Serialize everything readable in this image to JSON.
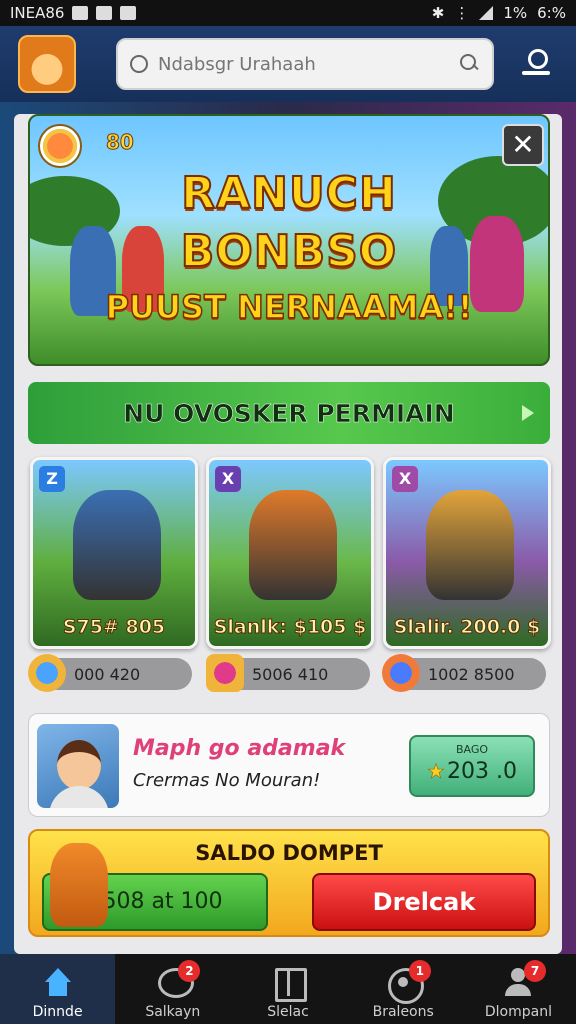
{
  "status_bar": {
    "left_text": "INEA86",
    "battery": "1%",
    "time": "6:%"
  },
  "header": {
    "search_placeholder": "Ndabsgr Urahaah"
  },
  "hero": {
    "score": "80",
    "title_line1": "RANUCH",
    "title_line2": "BONBSO",
    "subtitle": "PUUST NERNAAMA!!",
    "close_label": "✕"
  },
  "green_banner": {
    "label": "NU OVOSKER PERMIAIN"
  },
  "games": [
    {
      "tag": "Z",
      "tag_color": "#2a7de1",
      "price": "S75# 805",
      "stat": "000 420",
      "bg": "#5fae3e",
      "accent": "#3b6fb3"
    },
    {
      "tag": "X",
      "tag_color": "#6a3fb0",
      "price": "Slanlk: $105 $",
      "stat": "5006 410",
      "bg": "#6ab84a",
      "accent": "#e07a2a"
    },
    {
      "tag": "X",
      "tag_color": "#a04aa8",
      "price": "Slalir. 200.0 $",
      "stat": "1002 8500",
      "bg": "#8a5aa8",
      "accent": "#e3a43a"
    }
  ],
  "profile": {
    "name": "Maph go adamak",
    "subtitle": "Crermas No Mouran!",
    "reward_label": "BAGO",
    "reward_value": "203 .0"
  },
  "wallet": {
    "title": "SALDO DOMPET",
    "balance_label": "A508 at 100",
    "withdraw_label": "Drelcak"
  },
  "bottom_nav": [
    {
      "label": "Dinnde",
      "icon": "home-icon",
      "active": true,
      "badge": ""
    },
    {
      "label": "Salkayn",
      "icon": "chat-icon",
      "active": false,
      "badge": "2"
    },
    {
      "label": "Slelac",
      "icon": "book-icon",
      "active": false,
      "badge": ""
    },
    {
      "label": "Braleons",
      "icon": "shield-icon",
      "active": false,
      "badge": "1"
    },
    {
      "label": "Dlompanl",
      "icon": "person-icon",
      "active": false,
      "badge": "7"
    }
  ]
}
